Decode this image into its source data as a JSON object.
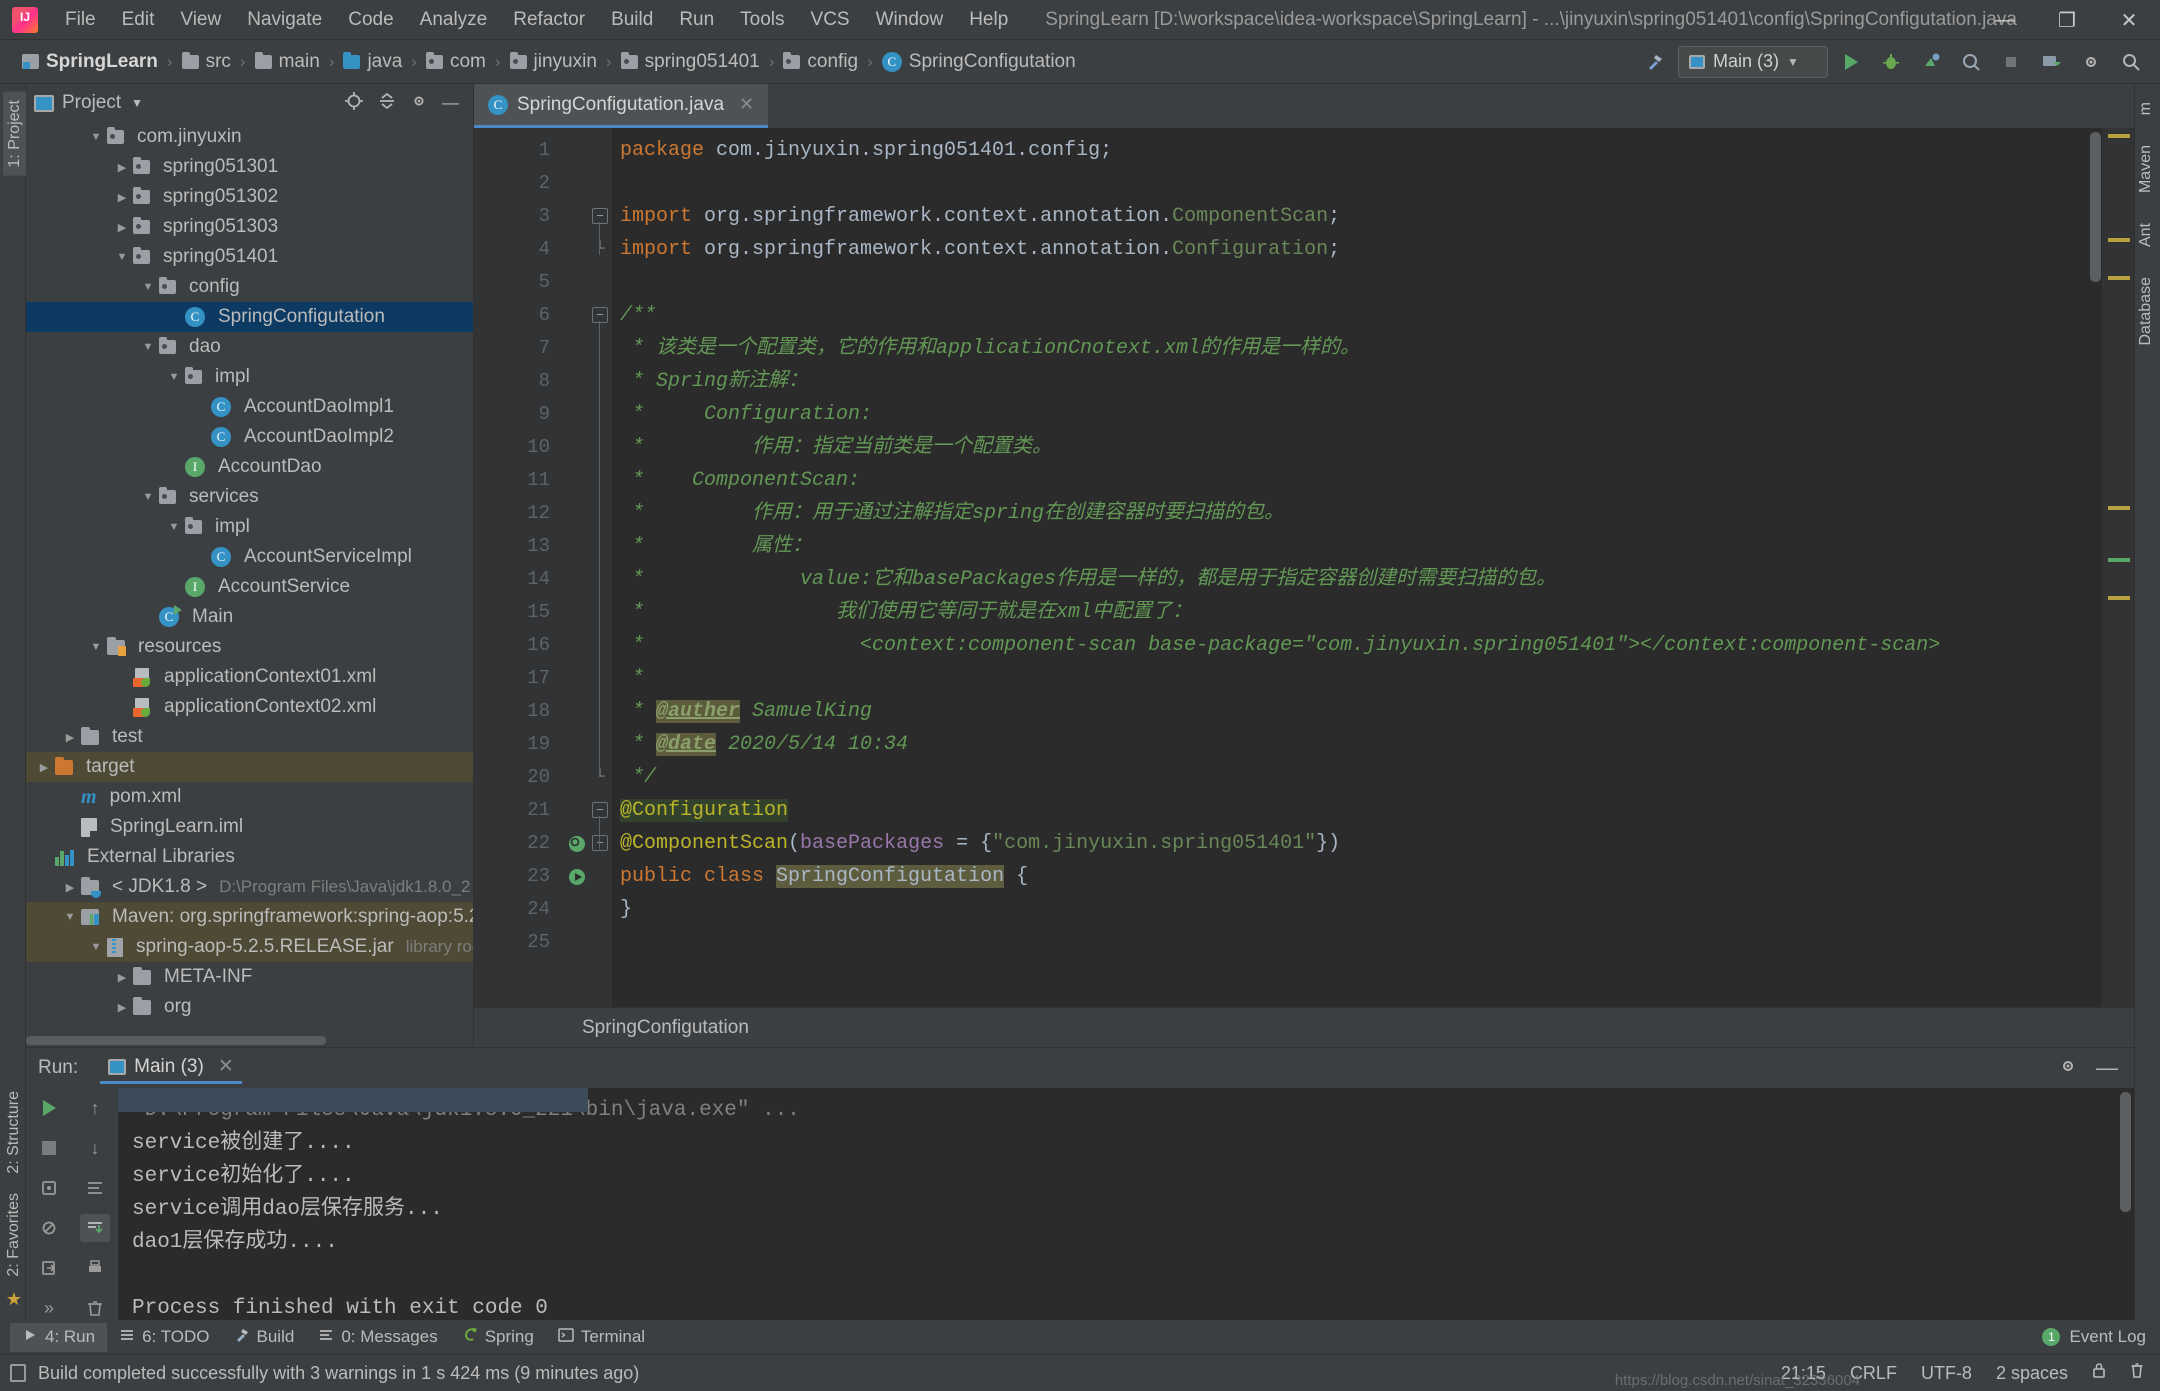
{
  "window": {
    "title": "SpringLearn [D:\\workspace\\idea-workspace\\SpringLearn] - ...\\jinyuxin\\spring051401\\config\\SpringConfigutation.java",
    "minimize": "—",
    "maximize": "❐",
    "close": "✕"
  },
  "menubar": [
    {
      "label": "File"
    },
    {
      "label": "Edit"
    },
    {
      "label": "View"
    },
    {
      "label": "Navigate"
    },
    {
      "label": "Code"
    },
    {
      "label": "Analyze"
    },
    {
      "label": "Refactor"
    },
    {
      "label": "Build"
    },
    {
      "label": "Run"
    },
    {
      "label": "Tools"
    },
    {
      "label": "VCS"
    },
    {
      "label": "Window"
    },
    {
      "label": "Help"
    }
  ],
  "breadcrumb": [
    {
      "label": "SpringLearn",
      "icon": "module-icon"
    },
    {
      "label": "src",
      "icon": "folder-icon"
    },
    {
      "label": "main",
      "icon": "folder-icon"
    },
    {
      "label": "java",
      "icon": "source-folder-icon"
    },
    {
      "label": "com",
      "icon": "package-icon"
    },
    {
      "label": "jinyuxin",
      "icon": "package-icon"
    },
    {
      "label": "spring051401",
      "icon": "package-icon"
    },
    {
      "label": "config",
      "icon": "package-icon"
    },
    {
      "label": "SpringConfigutation",
      "icon": "class-icon"
    }
  ],
  "toolbar": {
    "run_config": "Main (3)",
    "build_hammer": "build-icon",
    "run": "run-icon",
    "debug": "debug-icon",
    "run_coverage": "coverage-icon",
    "profile": "profile-icon",
    "stop": "stop-icon",
    "update": "update-icon",
    "settings": "settings-icon",
    "search": "search-icon"
  },
  "left_strip": {
    "tabs": [
      "1: Project"
    ],
    "bottom_tabs": [
      "2: Structure",
      "2: Favorites"
    ]
  },
  "right_strip": {
    "tabs": [
      "m",
      "Maven",
      "Ant",
      "Database"
    ]
  },
  "project_panel": {
    "title": "Project",
    "tree": [
      {
        "depth": 2,
        "arrow": "down",
        "icon": "package-icon",
        "label": "com.jinyuxin"
      },
      {
        "depth": 3,
        "arrow": "right",
        "icon": "package-icon",
        "label": "spring051301"
      },
      {
        "depth": 3,
        "arrow": "right",
        "icon": "package-icon",
        "label": "spring051302"
      },
      {
        "depth": 3,
        "arrow": "right",
        "icon": "package-icon",
        "label": "spring051303"
      },
      {
        "depth": 3,
        "arrow": "down",
        "icon": "package-icon",
        "label": "spring051401"
      },
      {
        "depth": 4,
        "arrow": "down",
        "icon": "package-icon",
        "label": "config"
      },
      {
        "depth": 5,
        "arrow": "none",
        "icon": "class-icon",
        "label": "SpringConfigutation",
        "state": "selected"
      },
      {
        "depth": 4,
        "arrow": "down",
        "icon": "package-icon",
        "label": "dao"
      },
      {
        "depth": 5,
        "arrow": "down",
        "icon": "package-icon",
        "label": "impl"
      },
      {
        "depth": 6,
        "arrow": "none",
        "icon": "class-icon",
        "label": "AccountDaoImpl1"
      },
      {
        "depth": 6,
        "arrow": "none",
        "icon": "class-icon",
        "label": "AccountDaoImpl2"
      },
      {
        "depth": 5,
        "arrow": "none",
        "icon": "interface-icon",
        "label": "AccountDao"
      },
      {
        "depth": 4,
        "arrow": "down",
        "icon": "package-icon",
        "label": "services"
      },
      {
        "depth": 5,
        "arrow": "down",
        "icon": "package-icon",
        "label": "impl"
      },
      {
        "depth": 6,
        "arrow": "none",
        "icon": "class-icon",
        "label": "AccountServiceImpl"
      },
      {
        "depth": 5,
        "arrow": "none",
        "icon": "interface-icon",
        "label": "AccountService"
      },
      {
        "depth": 4,
        "arrow": "none",
        "icon": "runnable-class-icon",
        "label": "Main"
      },
      {
        "depth": 2,
        "arrow": "down",
        "icon": "resources-folder-icon",
        "label": "resources"
      },
      {
        "depth": 3,
        "arrow": "none",
        "icon": "xml-spring-icon",
        "label": "applicationContext01.xml"
      },
      {
        "depth": 3,
        "arrow": "none",
        "icon": "xml-spring-icon",
        "label": "applicationContext02.xml"
      },
      {
        "depth": 1,
        "arrow": "right",
        "icon": "folder-icon",
        "label": "test"
      },
      {
        "depth": 0,
        "arrow": "right",
        "icon": "target-folder-icon",
        "label": "target",
        "state": "highlight"
      },
      {
        "depth": 1,
        "arrow": "none",
        "icon": "maven-pom-icon",
        "label": "pom.xml"
      },
      {
        "depth": 1,
        "arrow": "none",
        "icon": "iml-icon",
        "label": "SpringLearn.iml"
      },
      {
        "depth": 0,
        "arrow": "none",
        "icon": "external-libraries-icon",
        "label": "External Libraries"
      },
      {
        "depth": 1,
        "arrow": "right",
        "icon": "jdk-icon",
        "label": "< JDK1.8 >",
        "sub": "D:\\Program Files\\Java\\jdk1.8.0_2"
      },
      {
        "depth": 1,
        "arrow": "down",
        "icon": "maven-lib-icon",
        "label": "Maven: org.springframework:spring-aop:5.2.",
        "state": "highlight"
      },
      {
        "depth": 2,
        "arrow": "down",
        "icon": "jar-icon",
        "label": "spring-aop-5.2.5.RELEASE.jar",
        "sub": "library root",
        "state": "highlight"
      },
      {
        "depth": 3,
        "arrow": "right",
        "icon": "folder-icon",
        "label": "META-INF"
      },
      {
        "depth": 3,
        "arrow": "right",
        "icon": "folder-icon",
        "label": "org"
      }
    ]
  },
  "editor": {
    "tab": {
      "label": "SpringConfigutation.java",
      "icon": "class-icon",
      "close": "✕"
    },
    "breadcrumb_bottom": "SpringConfigutation",
    "lines": [
      {
        "n": 1,
        "tokens": [
          {
            "t": "package ",
            "c": "kw"
          },
          {
            "t": "com.jinyuxin.spring051401.config;",
            "c": "pln"
          }
        ]
      },
      {
        "n": 2,
        "tokens": []
      },
      {
        "n": 3,
        "fold": "minus",
        "tokens": [
          {
            "t": "import ",
            "c": "kw"
          },
          {
            "t": "org.springframework.context.annotation.",
            "c": "pln"
          },
          {
            "t": "ComponentScan",
            "c": "str"
          },
          {
            "t": ";",
            "c": "pln"
          }
        ]
      },
      {
        "n": 4,
        "fold": "end",
        "tokens": [
          {
            "t": "import ",
            "c": "kw"
          },
          {
            "t": "org.springframework.context.annotation.",
            "c": "pln"
          },
          {
            "t": "Configuration",
            "c": "str"
          },
          {
            "t": ";",
            "c": "pln"
          }
        ]
      },
      {
        "n": 5,
        "tokens": []
      },
      {
        "n": 6,
        "fold": "minus",
        "tokens": [
          {
            "t": "/**",
            "c": "cm"
          }
        ]
      },
      {
        "n": 7,
        "tokens": [
          {
            "t": " * 该类是一个配置类，它的作用和applicationCnotext.xml的作用是一样的。",
            "c": "cm"
          }
        ]
      },
      {
        "n": 8,
        "tokens": [
          {
            "t": " * Spring新注解：",
            "c": "cm"
          }
        ]
      },
      {
        "n": 9,
        "tokens": [
          {
            "t": " *     Configuration:",
            "c": "cm"
          }
        ]
      },
      {
        "n": 10,
        "tokens": [
          {
            "t": " *         作用：指定当前类是一个配置类。",
            "c": "cm"
          }
        ]
      },
      {
        "n": 11,
        "tokens": [
          {
            "t": " *    ComponentScan:",
            "c": "cm"
          }
        ]
      },
      {
        "n": 12,
        "tokens": [
          {
            "t": " *         作用：用于通过注解指定spring在创建容器时要扫描的包。",
            "c": "cm"
          }
        ]
      },
      {
        "n": 13,
        "tokens": [
          {
            "t": " *         属性：",
            "c": "cm"
          }
        ]
      },
      {
        "n": 14,
        "tokens": [
          {
            "t": " *             value:它和basePackages作用是一样的，都是用于指定容器创建时需要扫描的包。",
            "c": "cm"
          }
        ]
      },
      {
        "n": 15,
        "tokens": [
          {
            "t": " *                我们使用它等同于就是在xml中配置了：",
            "c": "cm"
          }
        ]
      },
      {
        "n": 16,
        "tokens": [
          {
            "t": " *                  <context:component-scan base-package=\"com.jinyuxin.spring051401\"></context:component-scan>",
            "c": "cm"
          }
        ]
      },
      {
        "n": 17,
        "tokens": [
          {
            "t": " *",
            "c": "cm"
          }
        ]
      },
      {
        "n": 18,
        "tokens": [
          {
            "t": " * ",
            "c": "cm"
          },
          {
            "t": "@auther",
            "c": "cmtag"
          },
          {
            "t": " SamuelKing",
            "c": "cm"
          }
        ]
      },
      {
        "n": 19,
        "tokens": [
          {
            "t": " * ",
            "c": "cm"
          },
          {
            "t": "@date",
            "c": "cmtag"
          },
          {
            "t": " 2020/5/14 10:34",
            "c": "cm"
          }
        ]
      },
      {
        "n": 20,
        "fold": "end",
        "tokens": [
          {
            "t": " */",
            "c": "cm"
          }
        ]
      },
      {
        "n": 21,
        "fold": "minus",
        "tokens": [
          {
            "t": "@Configuration",
            "c": "anno annohl"
          }
        ]
      },
      {
        "n": 22,
        "fold": "minus",
        "gutter_icon": "inspection-icon",
        "tokens": [
          {
            "t": "@ComponentScan",
            "c": "anno"
          },
          {
            "t": "(",
            "c": "pln"
          },
          {
            "t": "basePackages",
            "c": "ann-field"
          },
          {
            "t": " = {",
            "c": "pln"
          },
          {
            "t": "\"com.jinyuxin.spring051401\"",
            "c": "str"
          },
          {
            "t": "})",
            "c": "pln"
          }
        ]
      },
      {
        "n": 23,
        "gutter_icon": "runnable-icon",
        "tokens": [
          {
            "t": "public class ",
            "c": "kw"
          },
          {
            "t": "SpringConfigutation",
            "c": "cls-hl"
          },
          {
            "t": " {",
            "c": "pln"
          }
        ]
      },
      {
        "n": 24,
        "tokens": [
          {
            "t": "}",
            "c": "pln"
          }
        ]
      },
      {
        "n": 25,
        "tokens": []
      }
    ]
  },
  "run_panel": {
    "label": "Run:",
    "tab": "Main (3)",
    "tab_close": "✕",
    "settings_icon": "gear-icon",
    "minimize_icon": "minimize-icon",
    "toolbar_left": [
      "rerun-icon",
      "stop-icon",
      "dump-threads-icon",
      "mute-breakpoints-icon",
      "export-icon"
    ],
    "toolbar_right": [
      "scroll-up-icon",
      "scroll-down-icon",
      "soft-wrap-icon",
      "scroll-to-end-icon",
      "print-icon",
      "clear-all-icon"
    ],
    "overflow": "»",
    "console": [
      "\"D:\\Program Files\\Java\\jdk1.8.0_221\\bin\\java.exe\" ...",
      "service被创建了....",
      "service初始化了....",
      "service调用dao层保存服务...",
      "dao1层保存成功....",
      "",
      "Process finished with exit code 0"
    ]
  },
  "bottom_tools": [
    {
      "label": "4: Run",
      "underline": "4",
      "icon": "run-icon",
      "active": true
    },
    {
      "label": "6: TODO",
      "underline": "6",
      "icon": "todo-icon",
      "active": false
    },
    {
      "label": "Build",
      "underline": "",
      "icon": "build-icon",
      "active": false
    },
    {
      "label": "0: Messages",
      "underline": "0",
      "icon": "messages-icon",
      "active": false
    },
    {
      "label": "Spring",
      "underline": "",
      "icon": "spring-icon",
      "active": false
    },
    {
      "label": "Terminal",
      "underline": "",
      "icon": "terminal-icon",
      "active": false
    }
  ],
  "event_log": {
    "label": "Event Log",
    "badge": "1"
  },
  "statusbar": {
    "message": "Build completed successfully with 3 warnings in 1 s 424 ms (9 minutes ago)",
    "position": "21:15",
    "line_sep": "CRLF",
    "encoding": "UTF-8",
    "indent": "2 spaces",
    "lock_icon": "lock-icon",
    "watermark": "https://blog.csdn.net/sinat_32336004"
  }
}
